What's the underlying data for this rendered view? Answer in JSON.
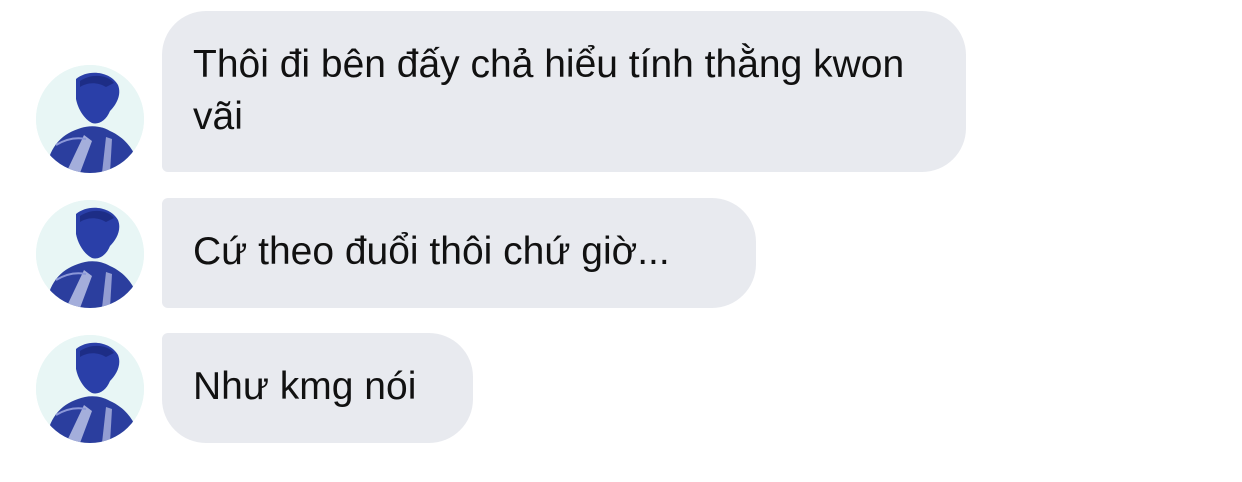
{
  "conversation": {
    "messages": [
      {
        "text": "Thôi đi bên đấy chả hiểu tính thằng kwon vãi"
      },
      {
        "text": "Cứ theo đuổi thôi chứ giờ..."
      },
      {
        "text": "Như kmg nói"
      }
    ],
    "avatar_icon": "profile-photo-icon",
    "colors": {
      "bubble": "#e8eaef",
      "text": "#111111",
      "avatar_bg": "#e8f6f5",
      "avatar_figure": "#2a3fa8"
    }
  }
}
